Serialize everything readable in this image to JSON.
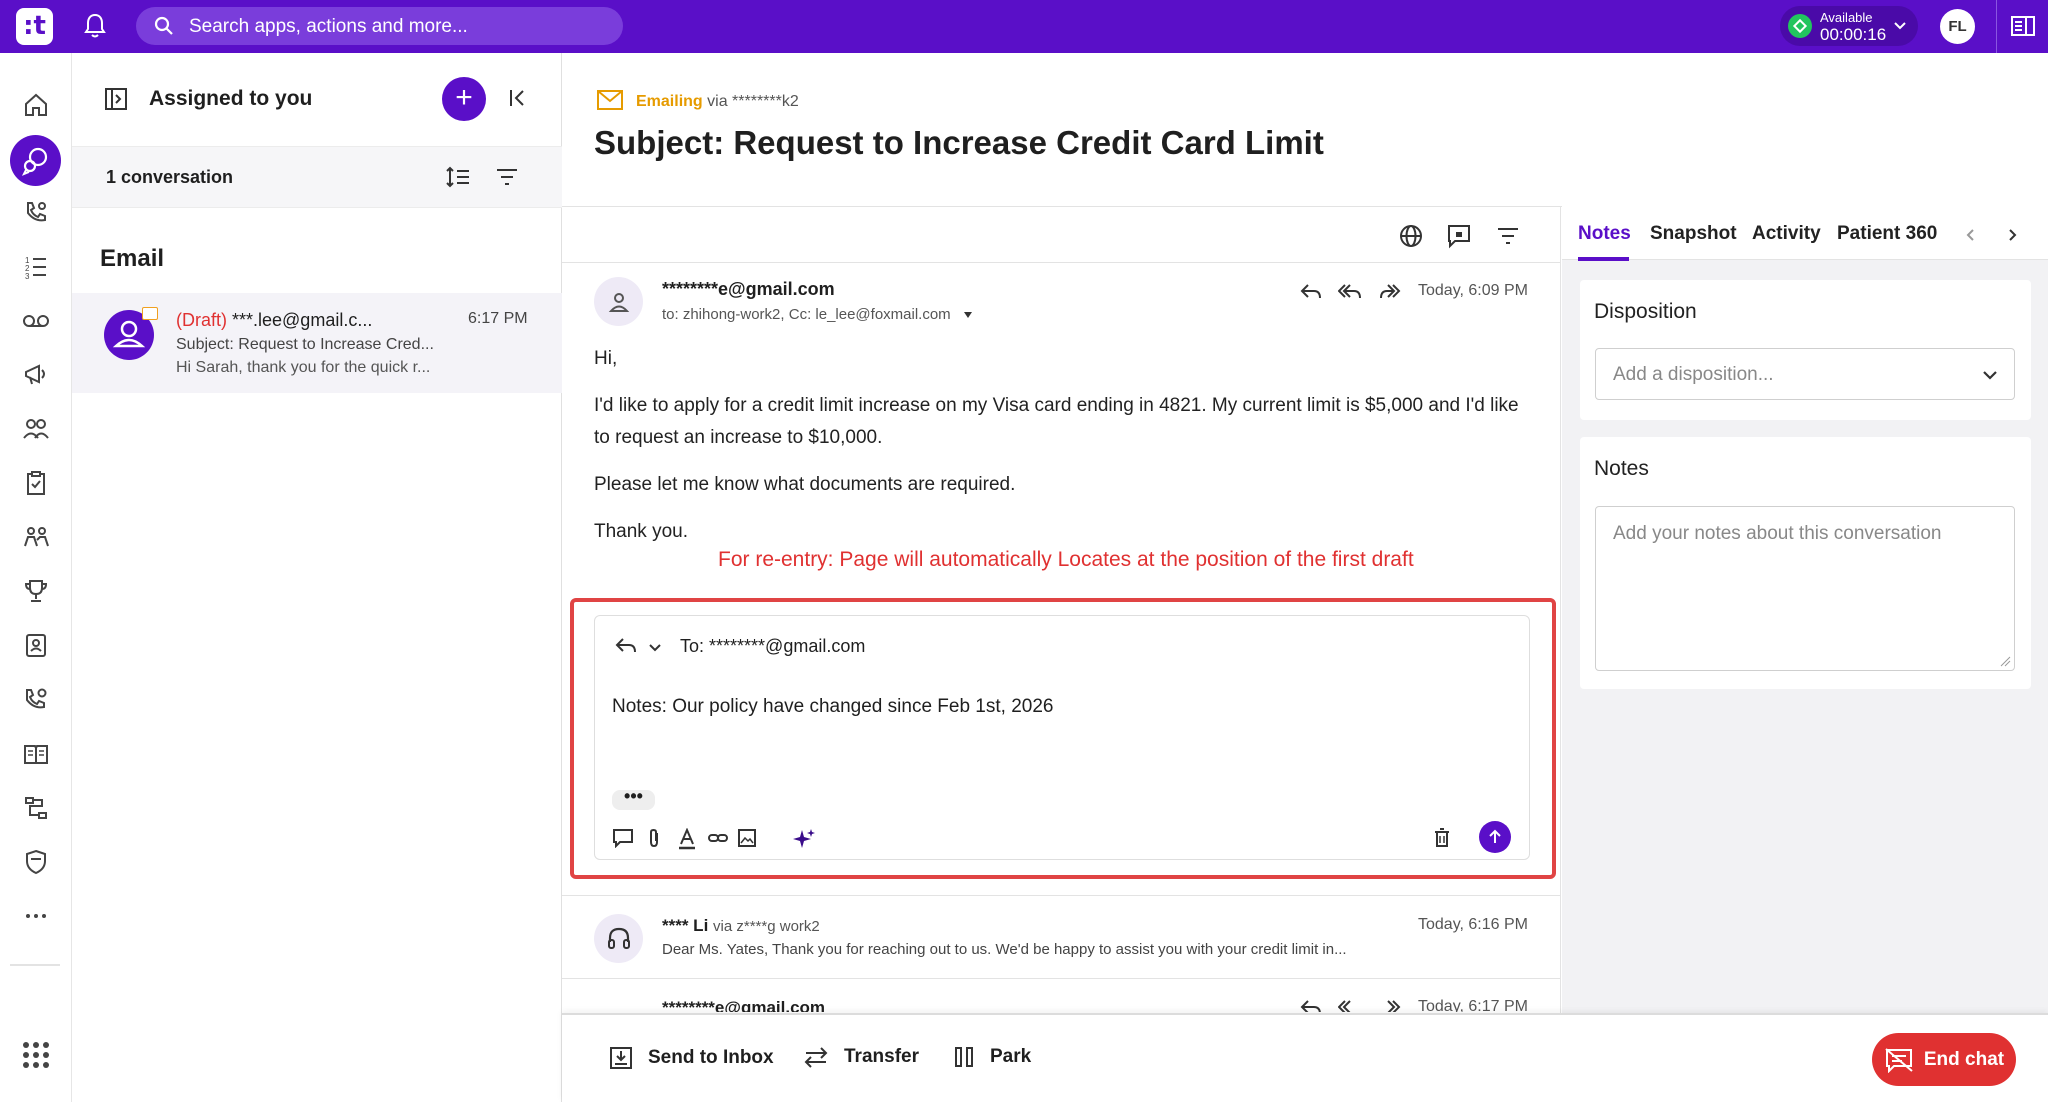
{
  "topbar": {
    "logo": ":t",
    "search_placeholder": "Search apps, actions and more...",
    "status_label": "Available",
    "status_time": "00:00:16",
    "user_initials": "FL"
  },
  "convlist": {
    "title": "Assigned to you",
    "count": "1 conversation",
    "section": "Email",
    "item": {
      "draft_tag": "(Draft)",
      "from": " ***.lee@gmail.c...",
      "time": "6:17 PM",
      "subject": "Subject: Request to Increase Cred...",
      "preview": "Hi Sarah, thank you for the quick r..."
    }
  },
  "main": {
    "channel": "Emailing",
    "via": "via ********k2",
    "subject": "Subject: Request to Increase Credit Card Limit",
    "message": {
      "from": "********e@gmail.com",
      "to": "to: zhihong-work2, Cc: le_lee@foxmail.com",
      "time": "Today, 6:09 PM",
      "greeting": "Hi,",
      "para1": "I'd like to apply for a credit limit increase on my Visa card ending in 4821. My current limit is $5,000 and I'd like to request an increase to $10,000.",
      "para2": "Please let me know what documents are required.",
      "closing": "Thank you."
    },
    "annotation": "For re-entry: Page will automatically Locates at the position of the first draft",
    "draft": {
      "to": "To: ********@gmail.com",
      "text": "Notes: Our policy have changed since Feb 1st, 2026",
      "more": "•••"
    },
    "message2": {
      "from": "**** Li",
      "via": "via z****g work2",
      "time": "Today, 6:16 PM",
      "preview": "Dear Ms. Yates, Thank you for reaching out to us. We'd be happy to assist you with your credit limit in..."
    },
    "message3": {
      "from": "********e@gmail.com",
      "time": "Today, 6:17 PM"
    }
  },
  "bottombar": {
    "send_to_inbox": "Send to Inbox",
    "transfer": "Transfer",
    "park": "Park",
    "end_chat": "End chat"
  },
  "rpanel": {
    "tabs": [
      "Notes",
      "Snapshot",
      "Activity",
      "Patient 360"
    ],
    "disposition_title": "Disposition",
    "disposition_placeholder": "Add a disposition...",
    "notes_title": "Notes",
    "notes_placeholder": "Add your notes about this conversation"
  },
  "colors": {
    "brand": "#5a0fc8",
    "danger": "#e03131",
    "email_accent": "#e69b00"
  }
}
